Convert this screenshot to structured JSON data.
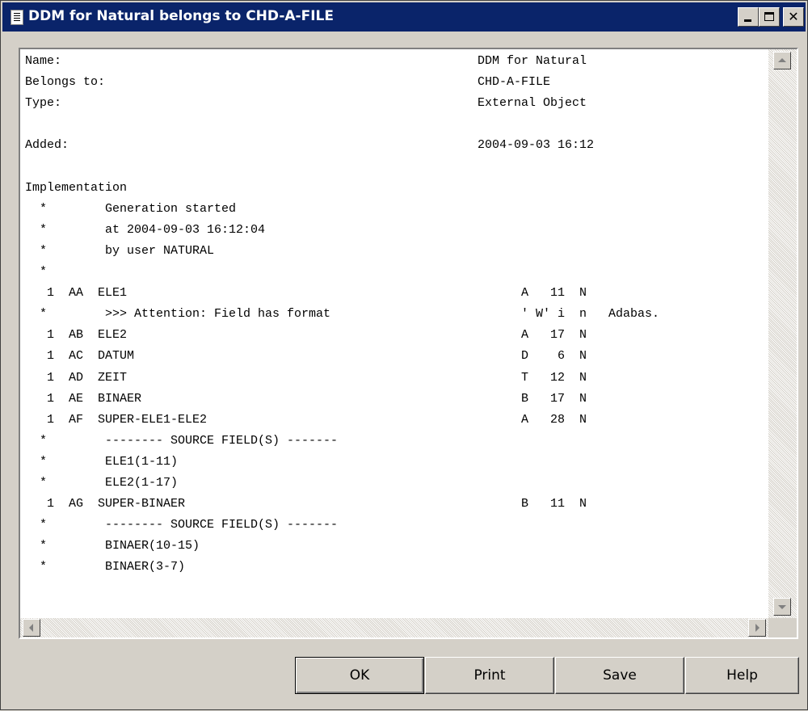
{
  "window": {
    "title": "DDM for Natural belongs to CHD-A-FILE",
    "controls": {
      "minimize": "_",
      "maximize": "□",
      "close": "✕"
    }
  },
  "content": {
    "lines": [
      {
        "c1": "Name:",
        "c2": "DDM for Natural"
      },
      {
        "c1": "Belongs to:",
        "c2": "CHD-A-FILE"
      },
      {
        "c1": "Type:",
        "c2": "External Object"
      },
      {
        "c1": "",
        "c2": ""
      },
      {
        "c1": "Added:",
        "c2": "2004-09-03 16:12"
      },
      {
        "c1": "",
        "c2": ""
      },
      {
        "c1": "Implementation",
        "c2": ""
      },
      {
        "c1": "  *        Generation started",
        "c2": ""
      },
      {
        "c1": "  *        at 2004-09-03 16:12:04",
        "c2": ""
      },
      {
        "c1": "  *        by user NATURAL",
        "c2": ""
      },
      {
        "c1": "  *",
        "c2": ""
      },
      {
        "c1": "   1  AA  ELE1",
        "c2": "A   11  N"
      },
      {
        "c1": "  *        >>> Attention: Field has format",
        "c2": "' W' i  n   Adabas."
      },
      {
        "c1": "   1  AB  ELE2",
        "c2": "A   17  N"
      },
      {
        "c1": "   1  AC  DATUM",
        "c2": "D    6  N"
      },
      {
        "c1": "   1  AD  ZEIT",
        "c2": "T   12  N"
      },
      {
        "c1": "   1  AE  BINAER",
        "c2": "B   17  N"
      },
      {
        "c1": "   1  AF  SUPER-ELE1-ELE2",
        "c2": "A   28  N"
      },
      {
        "c1": "  *        -------- SOURCE FIELD(S) -------",
        "c2": ""
      },
      {
        "c1": "  *        ELE1(1-11)",
        "c2": ""
      },
      {
        "c1": "  *        ELE2(1-17)",
        "c2": ""
      },
      {
        "c1": "   1  AG  SUPER-BINAER",
        "c2": "B   11  N"
      },
      {
        "c1": "  *        -------- SOURCE FIELD(S) -------",
        "c2": ""
      },
      {
        "c1": "  *        BINAER(10-15)",
        "c2": ""
      },
      {
        "c1": "  *        BINAER(3-7)",
        "c2": ""
      }
    ]
  },
  "buttons": {
    "ok": "OK",
    "print": "Print",
    "save": "Save",
    "help": "Help"
  },
  "colors": {
    "titlebar": "#0a246a",
    "face": "#d4d0c8",
    "content_bg": "#ffffff"
  }
}
